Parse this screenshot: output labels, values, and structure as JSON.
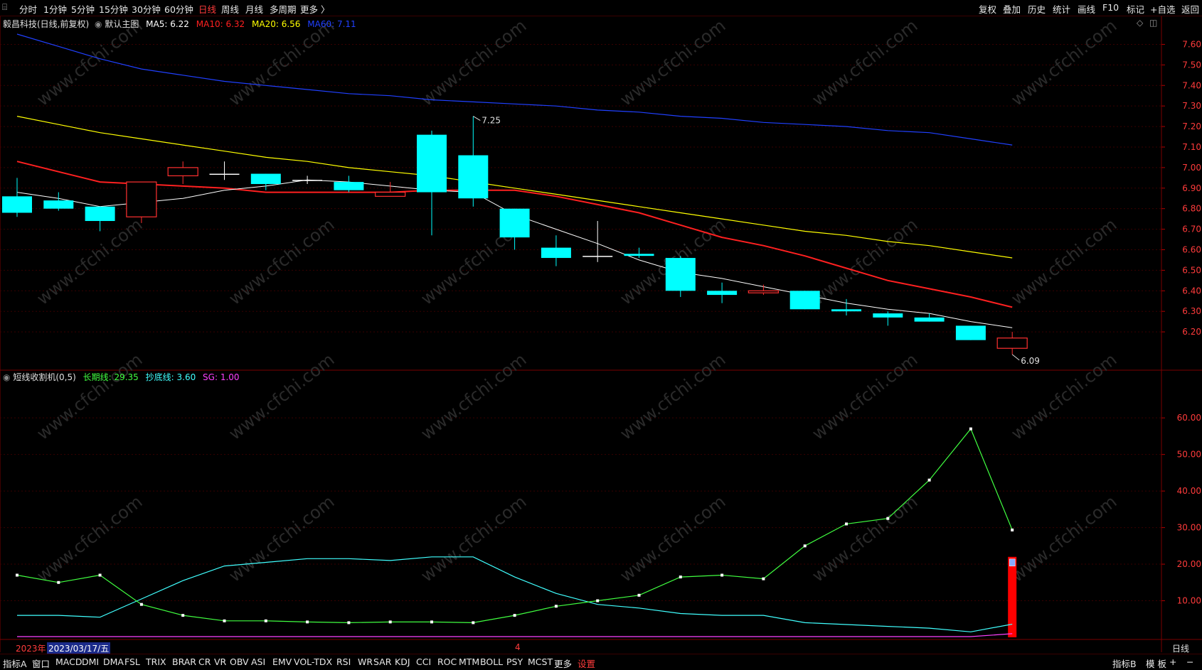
{
  "topbar": {
    "periods": [
      "分时",
      "1分钟",
      "5分钟",
      "15分钟",
      "30分钟",
      "60分钟",
      "日线",
      "周线",
      "月线",
      "多周期",
      "更多 〉"
    ],
    "active_period": "日线",
    "right_buttons": [
      "复权",
      "叠加",
      "历史",
      "统计",
      "画线",
      "F10",
      "标记",
      "+自选",
      "返回"
    ]
  },
  "main_panel": {
    "stock_label": "毅昌科技(日线,前复权)",
    "template_label": "默认主图",
    "ma": [
      {
        "label": "MA5: 6.22",
        "color": "#ffffff"
      },
      {
        "label": "MA10: 6.32",
        "color": "#ff2020"
      },
      {
        "label": "MA20: 6.56",
        "color": "#ffff00"
      },
      {
        "label": "MA60: 7.11",
        "color": "#2040ff"
      }
    ],
    "high_marker": "7.25",
    "low_marker": "6.09",
    "price_axis": [
      "7.60",
      "7.50",
      "7.40",
      "7.30",
      "7.20",
      "7.10",
      "7.00",
      "6.90",
      "6.80",
      "6.70",
      "6.60",
      "6.50",
      "6.40",
      "6.30",
      "6.20"
    ]
  },
  "indicator_panel": {
    "name": "短线收割机(0,5)",
    "lines": [
      {
        "label": "长期线: 29.35",
        "color": "#40ff40"
      },
      {
        "label": "抄底线: 3.60",
        "color": "#40ffff"
      },
      {
        "label": "SG: 1.00",
        "color": "#ff40ff"
      }
    ],
    "axis": [
      "60.00",
      "50.00",
      "40.00",
      "30.00",
      "20.00",
      "10.00"
    ]
  },
  "date_bar": {
    "year": "2023年",
    "date": "2023/03/17/五",
    "month_marker": "4",
    "period_label": "日线"
  },
  "watermark": "www.cfchi.com",
  "bottombar": {
    "tabs": [
      "指标A",
      "窗口",
      "MACD",
      "DMI",
      "DMA",
      "FSL",
      "TRIX",
      "BRAR",
      "CR",
      "VR",
      "OBV",
      "ASI",
      "EMV",
      "VOL-TDX",
      "RSI",
      "WR",
      "SAR",
      "KDJ",
      "CCI",
      "ROC",
      "MTM",
      "BOLL",
      "PSY",
      "MCST",
      "更多",
      "设置"
    ],
    "right_tabs": [
      "指标B",
      "模 板",
      "+",
      "−"
    ]
  },
  "chart_data": {
    "type": "candlestick",
    "candles": [
      {
        "o": 6.86,
        "h": 6.95,
        "l": 6.76,
        "c": 6.78
      },
      {
        "o": 6.84,
        "h": 6.88,
        "l": 6.79,
        "c": 6.8
      },
      {
        "o": 6.81,
        "h": 6.81,
        "l": 6.69,
        "c": 6.74
      },
      {
        "o": 6.76,
        "h": 6.93,
        "l": 6.73,
        "c": 6.93
      },
      {
        "o": 6.96,
        "h": 7.03,
        "l": 6.92,
        "c": 7.0
      },
      {
        "o": 6.97,
        "h": 7.03,
        "l": 6.94,
        "c": 6.97
      },
      {
        "o": 6.97,
        "h": 6.97,
        "l": 6.89,
        "c": 6.92
      },
      {
        "o": 6.94,
        "h": 6.96,
        "l": 6.92,
        "c": 6.94
      },
      {
        "o": 6.93,
        "h": 6.96,
        "l": 6.88,
        "c": 6.89
      },
      {
        "o": 6.86,
        "h": 6.93,
        "l": 6.86,
        "c": 6.88
      },
      {
        "o": 7.16,
        "h": 7.18,
        "l": 6.67,
        "c": 6.88
      },
      {
        "o": 7.06,
        "h": 7.25,
        "l": 6.81,
        "c": 6.85
      },
      {
        "o": 6.8,
        "h": 6.8,
        "l": 6.6,
        "c": 6.66
      },
      {
        "o": 6.61,
        "h": 6.67,
        "l": 6.52,
        "c": 6.56
      },
      {
        "o": 6.57,
        "h": 6.74,
        "l": 6.54,
        "c": 6.57
      },
      {
        "o": 6.58,
        "h": 6.61,
        "l": 6.56,
        "c": 6.57
      },
      {
        "o": 6.56,
        "h": 6.57,
        "l": 6.37,
        "c": 6.4
      },
      {
        "o": 6.4,
        "h": 6.44,
        "l": 6.34,
        "c": 6.38
      },
      {
        "o": 6.39,
        "h": 6.43,
        "l": 6.38,
        "c": 6.4
      },
      {
        "o": 6.4,
        "h": 6.4,
        "l": 6.31,
        "c": 6.31
      },
      {
        "o": 6.31,
        "h": 6.36,
        "l": 6.28,
        "c": 6.3
      },
      {
        "o": 6.29,
        "h": 6.3,
        "l": 6.23,
        "c": 6.27
      },
      {
        "o": 6.27,
        "h": 6.29,
        "l": 6.25,
        "c": 6.25
      },
      {
        "o": 6.23,
        "h": 6.23,
        "l": 6.16,
        "c": 6.16
      },
      {
        "o": 6.12,
        "h": 6.2,
        "l": 6.09,
        "c": 6.17
      }
    ],
    "ma5": [
      6.88,
      6.85,
      6.81,
      6.83,
      6.85,
      6.89,
      6.91,
      6.94,
      6.93,
      6.91,
      6.89,
      6.88,
      6.77,
      6.7,
      6.63,
      6.55,
      6.49,
      6.46,
      6.42,
      6.38,
      6.34,
      6.31,
      6.29,
      6.25,
      6.22
    ],
    "ma10": [
      7.03,
      6.98,
      6.93,
      6.92,
      6.91,
      6.9,
      6.88,
      6.88,
      6.88,
      6.88,
      6.89,
      6.89,
      6.89,
      6.86,
      6.82,
      6.78,
      6.72,
      6.66,
      6.62,
      6.57,
      6.51,
      6.45,
      6.41,
      6.37,
      6.32
    ],
    "ma20": [
      7.25,
      7.21,
      7.17,
      7.14,
      7.11,
      7.08,
      7.05,
      7.03,
      7.0,
      6.98,
      6.96,
      6.93,
      6.9,
      6.87,
      6.84,
      6.81,
      6.78,
      6.75,
      6.72,
      6.69,
      6.67,
      6.64,
      6.62,
      6.59,
      6.56
    ],
    "ma60": [
      7.65,
      7.59,
      7.53,
      7.48,
      7.45,
      7.42,
      7.4,
      7.38,
      7.36,
      7.35,
      7.33,
      7.32,
      7.31,
      7.3,
      7.28,
      7.27,
      7.25,
      7.24,
      7.22,
      7.21,
      7.2,
      7.18,
      7.17,
      7.14,
      7.11
    ],
    "ind_long": [
      17.0,
      15.0,
      17.0,
      9.0,
      6.0,
      4.5,
      4.5,
      4.2,
      4.0,
      4.2,
      4.2,
      4.0,
      6.0,
      8.5,
      10.0,
      11.5,
      16.5,
      17.0,
      16.0,
      25.0,
      31.0,
      32.5,
      43.0,
      57.0,
      29.35
    ],
    "ind_dip": [
      6.0,
      6.0,
      5.5,
      10.5,
      15.5,
      19.5,
      20.5,
      21.5,
      21.5,
      21.0,
      22.0,
      22.0,
      16.5,
      12.0,
      9.0,
      8.0,
      6.5,
      6.0,
      6.0,
      4.0,
      3.5,
      3.0,
      2.5,
      1.5,
      3.6
    ],
    "ind_sg": [
      0.2,
      0.2,
      0.2,
      0.2,
      0.2,
      0.2,
      0.2,
      0.2,
      0.2,
      0.2,
      0.2,
      0.2,
      0.2,
      0.2,
      0.2,
      0.2,
      0.2,
      0.2,
      0.2,
      0.2,
      0.2,
      0.2,
      0.2,
      0.2,
      1.0
    ],
    "signal_bar": {
      "index": 24,
      "value": 22.0
    },
    "price_range": [
      6.1,
      7.65
    ],
    "ind_range": [
      0,
      68
    ]
  }
}
